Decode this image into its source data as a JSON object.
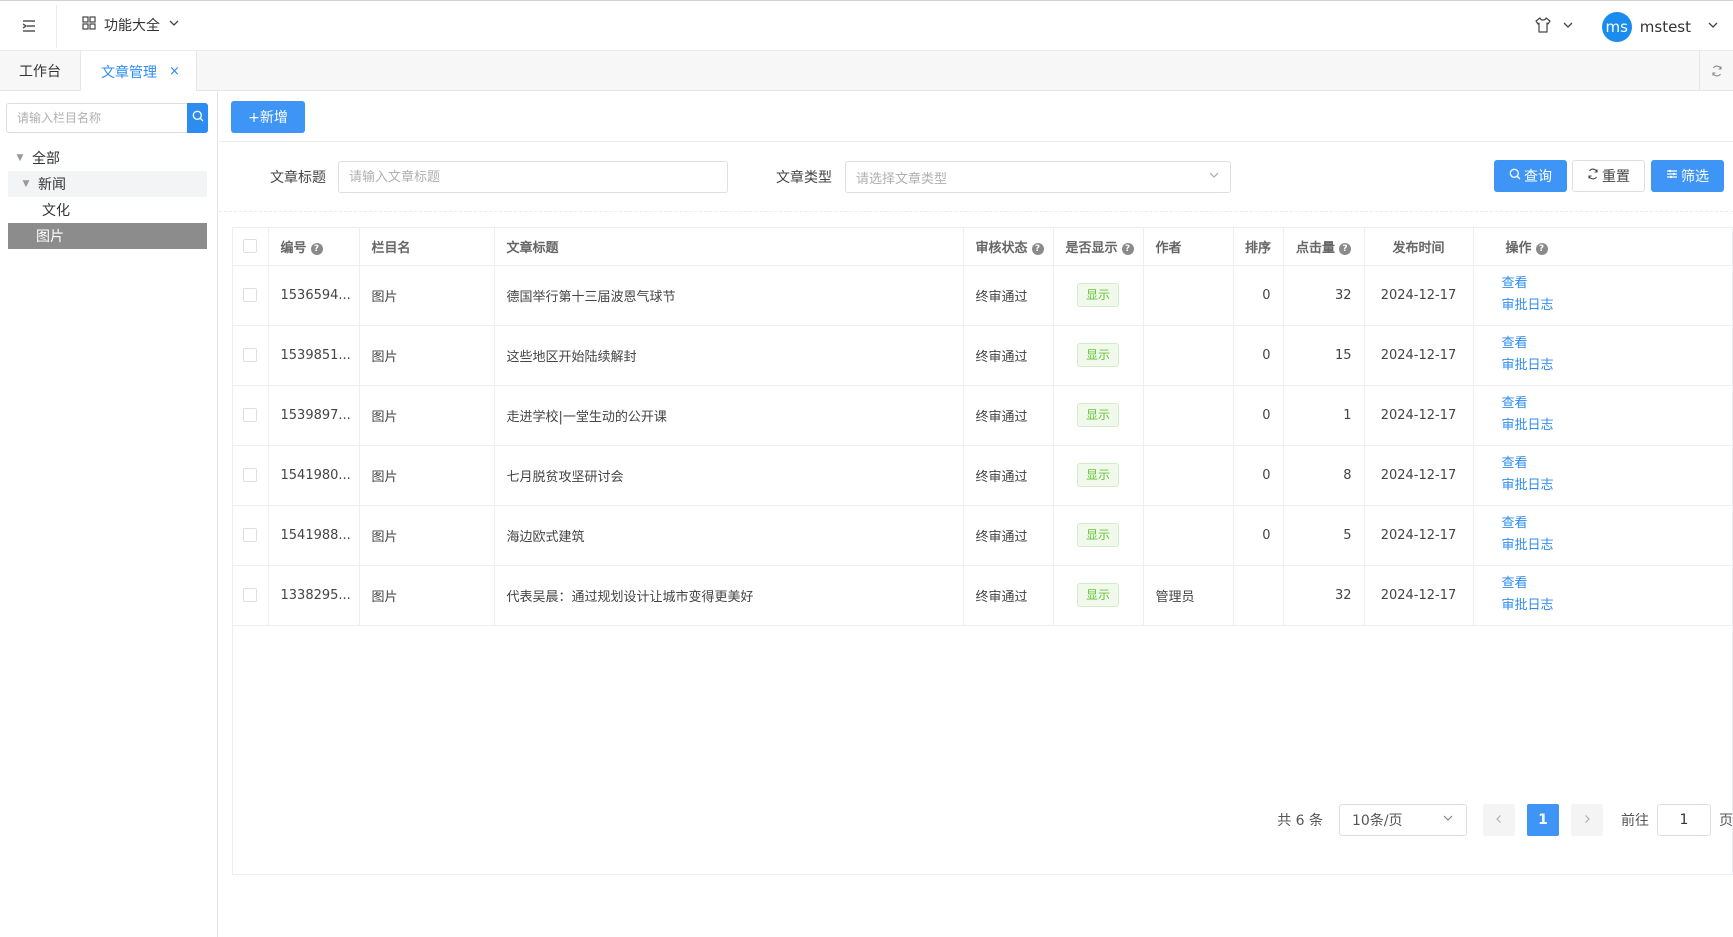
{
  "header": {
    "feature_menu": "功能大全",
    "user": {
      "avatar_text": "ms",
      "name": "mstest"
    }
  },
  "tabs": [
    {
      "label": "工作台"
    },
    {
      "label": "文章管理",
      "close": "×"
    }
  ],
  "sidebar": {
    "search_placeholder": "请输入栏目名称",
    "tree": [
      {
        "label": "全部"
      },
      {
        "label": "新闻"
      },
      {
        "label": "文化"
      },
      {
        "label": "图片"
      }
    ]
  },
  "toolbar": {
    "add_label": "+新增"
  },
  "filters": {
    "title_label": "文章标题",
    "title_placeholder": "请输入文章标题",
    "type_label": "文章类型",
    "type_placeholder": "请选择文章类型",
    "query": "查询",
    "reset": "重置",
    "filter": "筛选"
  },
  "table": {
    "columns": [
      "编号",
      "栏目名",
      "文章标题",
      "审核状态",
      "是否显示",
      "作者",
      "排序",
      "点击量",
      "发布时间",
      "操作"
    ],
    "rows": [
      {
        "id": "1536594...",
        "column": "图片",
        "title": "德国举行第十三届波恩气球节",
        "status": "终审通过",
        "display": "显示",
        "author": "",
        "sort": "0",
        "clicks": "32",
        "date": "2024-12-17",
        "op_view": "查看",
        "op_log": "审批日志"
      },
      {
        "id": "1539851...",
        "column": "图片",
        "title": "这些地区开始陆续解封",
        "status": "终审通过",
        "display": "显示",
        "author": "",
        "sort": "0",
        "clicks": "15",
        "date": "2024-12-17",
        "op_view": "查看",
        "op_log": "审批日志"
      },
      {
        "id": "1539897...",
        "column": "图片",
        "title": "走进学校|一堂生动的公开课",
        "status": "终审通过",
        "display": "显示",
        "author": "",
        "sort": "0",
        "clicks": "1",
        "date": "2024-12-17",
        "op_view": "查看",
        "op_log": "审批日志"
      },
      {
        "id": "1541980...",
        "column": "图片",
        "title": "七月脱贫攻坚研讨会",
        "status": "终审通过",
        "display": "显示",
        "author": "",
        "sort": "0",
        "clicks": "8",
        "date": "2024-12-17",
        "op_view": "查看",
        "op_log": "审批日志"
      },
      {
        "id": "1541988...",
        "column": "图片",
        "title": "海边欧式建筑",
        "status": "终审通过",
        "display": "显示",
        "author": "",
        "sort": "0",
        "clicks": "5",
        "date": "2024-12-17",
        "op_view": "查看",
        "op_log": "审批日志"
      },
      {
        "id": "1338295...",
        "column": "图片",
        "title": "代表吴晨：通过规划设计让城市变得更美好",
        "status": "终审通过",
        "display": "显示",
        "author": "管理员",
        "sort": "",
        "clicks": "32",
        "date": "2024-12-17",
        "op_view": "查看",
        "op_log": "审批日志"
      }
    ]
  },
  "pagination": {
    "total": "共 6 条",
    "page_size": "10条/页",
    "current_page": "1",
    "goto_label": "前往",
    "goto_value": "1",
    "page_unit": "页"
  },
  "colors": {
    "primary": "#3e95f5",
    "link": "#2d8cf0",
    "tag_green": "#67c23a",
    "tree_selected": "#8c8c8c"
  }
}
